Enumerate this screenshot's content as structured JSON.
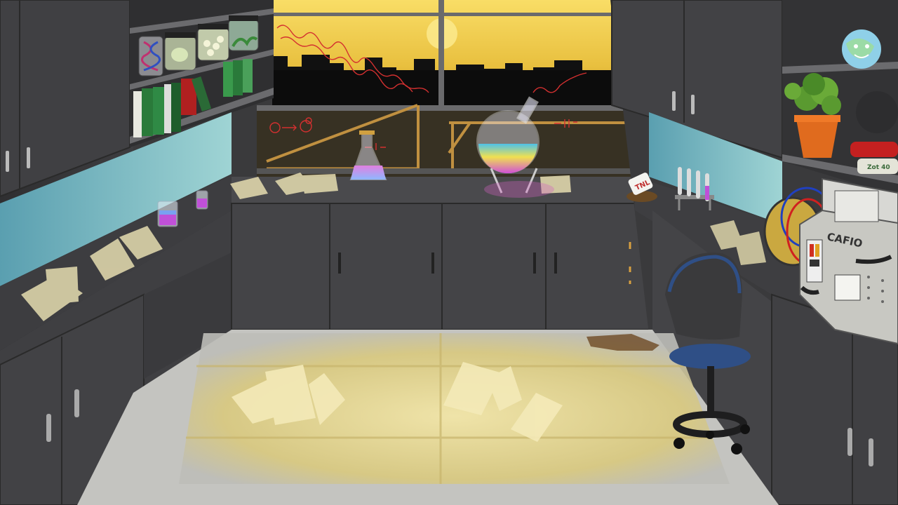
{
  "scene": {
    "background_name": "chemistry-lab-at-sunset",
    "skyline": "city-silhouette"
  },
  "machine": {
    "label": "CAFIO"
  },
  "mug": {
    "label": "TNL"
  },
  "bottle": {
    "label": "Zot 40"
  },
  "colors": {
    "sky_top": "#f6d45a",
    "sky_bottom": "#c8a02a",
    "wall": "#3b3b3d",
    "cabinet": "#474749",
    "backsplash": "#7cc4cf",
    "floor_light": "#efe4a8",
    "chair_seat": "#2f4f86",
    "formula_red": "#d43030"
  }
}
